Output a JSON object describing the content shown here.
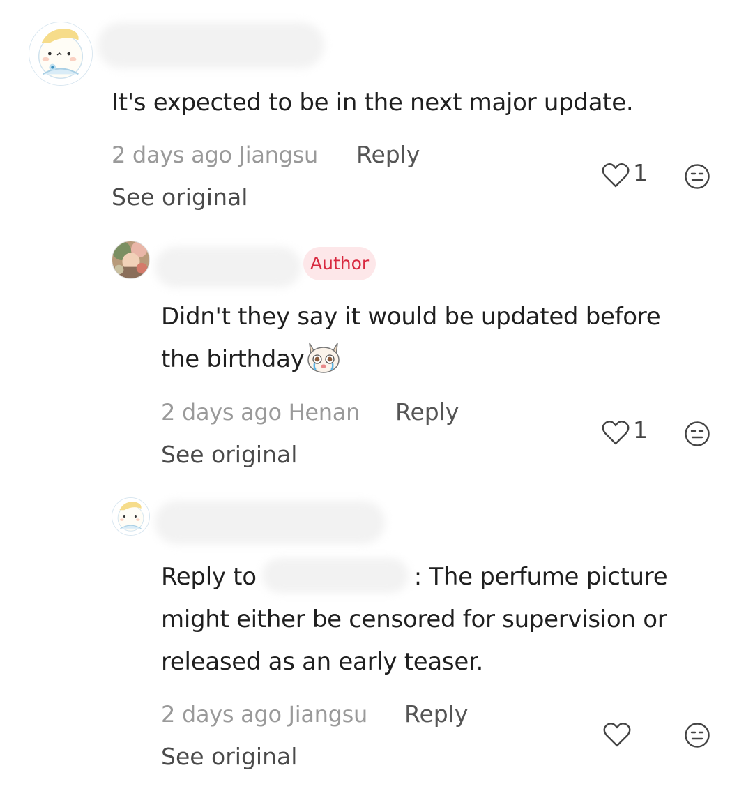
{
  "comments": [
    {
      "text_lines": [
        "It's expected to be in the next major update."
      ],
      "timestamp": "2 days ago",
      "location": "Jiangsu",
      "reply_label": "Reply",
      "see_original_label": "See original",
      "like_count": "1",
      "avatar_icon": "cartoon-avatar",
      "like_icon": "heart-outline-icon",
      "dislike_icon": "meh-face-icon"
    },
    {
      "badge": "Author",
      "text_lines": [
        "Didn't they say it would be updated before",
        "the birthday"
      ],
      "emoji_icon": "crying-cat-emoji",
      "timestamp": "2 days ago",
      "location": "Henan",
      "reply_label": "Reply",
      "see_original_label": "See original",
      "like_count": "1",
      "avatar_icon": "photo-avatar",
      "like_icon": "heart-outline-icon",
      "dislike_icon": "meh-face-icon"
    },
    {
      "reply_to_prefix": "Reply to",
      "reply_to_suffix": ": The perfume picture",
      "text_lines": [
        "might either be censored for supervision or",
        "released as an early teaser."
      ],
      "timestamp": "2 days ago",
      "location": "Jiangsu",
      "reply_label": "Reply",
      "see_original_label": "See original",
      "like_count": "",
      "avatar_icon": "cartoon-avatar",
      "like_icon": "heart-outline-icon",
      "dislike_icon": "meh-face-icon"
    }
  ],
  "colors": {
    "badge_text": "#d8283f",
    "badge_bg": "#fde7e9",
    "meta_text": "#9a9a9a",
    "body_text": "#1f1f1f"
  }
}
